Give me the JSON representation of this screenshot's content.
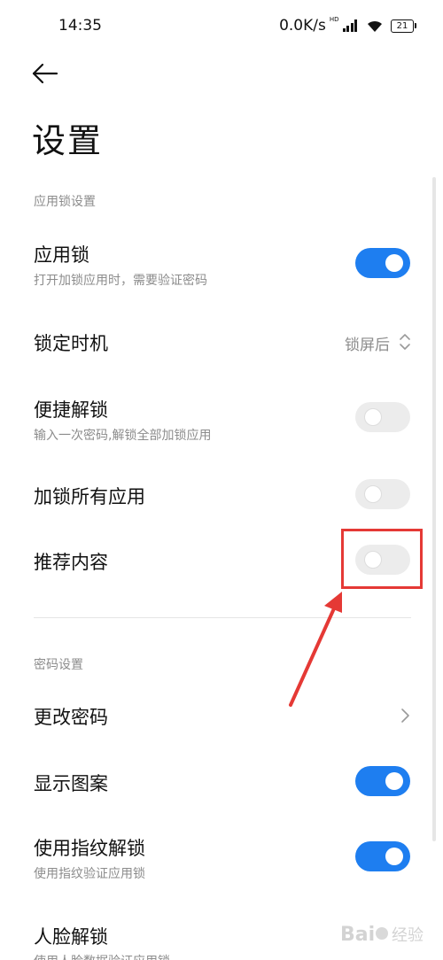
{
  "status_bar": {
    "time": "14:35",
    "net_speed": "0.0K/s",
    "hd_label": "HD",
    "battery": "21"
  },
  "nav": {
    "back_icon": "arrow-left-icon"
  },
  "page": {
    "title": "设置"
  },
  "sections": {
    "app_lock_header": "应用锁设置",
    "password_header": "密码设置"
  },
  "rows": {
    "app_lock": {
      "title": "应用锁",
      "subtitle": "打开加锁应用时，需要验证密码",
      "toggle": "on"
    },
    "lock_timing": {
      "title": "锁定时机",
      "value": "锁屏后",
      "icon": "up-down-chevron-icon"
    },
    "quick_unlock": {
      "title": "便捷解锁",
      "subtitle": "输入一次密码,解锁全部加锁应用",
      "toggle": "off"
    },
    "lock_all_apps": {
      "title": "加锁所有应用",
      "toggle": "off"
    },
    "recommended_content": {
      "title": "推荐内容",
      "toggle": "off"
    },
    "change_password": {
      "title": "更改密码",
      "icon": "chevron-right-icon"
    },
    "show_pattern": {
      "title": "显示图案",
      "toggle": "on"
    },
    "fingerprint_unlock": {
      "title": "使用指纹解锁",
      "subtitle": "使用指纹验证应用锁",
      "toggle": "on"
    },
    "face_unlock": {
      "title": "人脸解锁",
      "subtitle": "使用人脸数据验证应用锁"
    }
  },
  "annotation": {
    "color": "#e53935"
  },
  "watermark": {
    "text": "Bai经验"
  },
  "colors": {
    "accent": "#1e7ef0",
    "toggle_off": "#ececec",
    "secondary_text": "#8c8c8c"
  }
}
